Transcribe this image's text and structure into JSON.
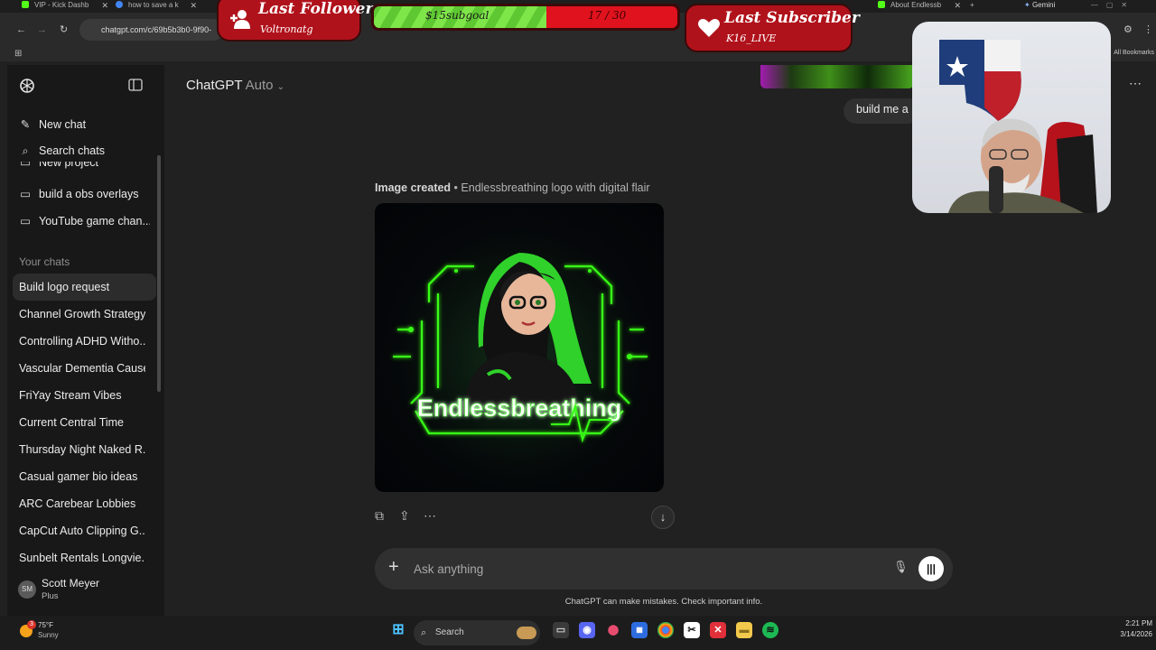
{
  "browser": {
    "tabs": [
      {
        "title": "VIP - Kick Dashb",
        "color": "#53fc18"
      },
      {
        "title": "how to save a k",
        "color": "#4285f4"
      },
      {
        "title": "About Endlessb",
        "color": "#53fc18"
      }
    ],
    "gemini_label": "Gemini",
    "url": "chatgpt.com/c/69b5b3b0-9f90-",
    "all_bookmarks": "All Bookmarks"
  },
  "overlays": {
    "last_follower": {
      "title": "Last Follower",
      "name": "Voltronatg"
    },
    "goal": {
      "label": "$15subgoal",
      "count": "17 / 30",
      "progress": 0.567
    },
    "last_subscriber": {
      "title": "Last Subscriber",
      "name": "K16_LIVE"
    }
  },
  "sidebar": {
    "new_chat": "New chat",
    "search_chats": "Search chats",
    "new_project": "New project",
    "projects": [
      "build a obs overlays",
      "YouTube game chan..."
    ],
    "section_label": "Your chats",
    "chats": [
      "Build logo request",
      "Channel Growth Strategy",
      "Controlling ADHD Witho...",
      "Vascular Dementia Causes",
      "FriYay Stream Vibes",
      "Current Central Time",
      "Thursday Night Naked R...",
      "Casual gamer bio ideas",
      "ARC Carebear Lobbies",
      "CapCut Auto Clipping G...",
      "Sunbelt Rentals Longvie..."
    ],
    "user": {
      "initials": "SM",
      "name": "Scott Meyer",
      "plan": "Plus"
    }
  },
  "main": {
    "title": "ChatGPT",
    "model": "Auto",
    "user_message": "build me a",
    "image_caption_prefix": "Image created",
    "image_caption_sep": " • ",
    "image_caption": "Endlessbreathing logo with digital flair",
    "logo_text": "Endlessbreathing",
    "composer_placeholder": "Ask anything",
    "disclaimer": "ChatGPT can make mistakes. Check important info."
  },
  "taskbar": {
    "weather_temp": "75°F",
    "weather_desc": "Sunny",
    "weather_badge": "3",
    "search_label": "Search",
    "time": "2:21 PM",
    "date": "3/14/2026"
  },
  "colors": {
    "accent_green": "#39ff14",
    "overlay_red": "#b0121b"
  }
}
